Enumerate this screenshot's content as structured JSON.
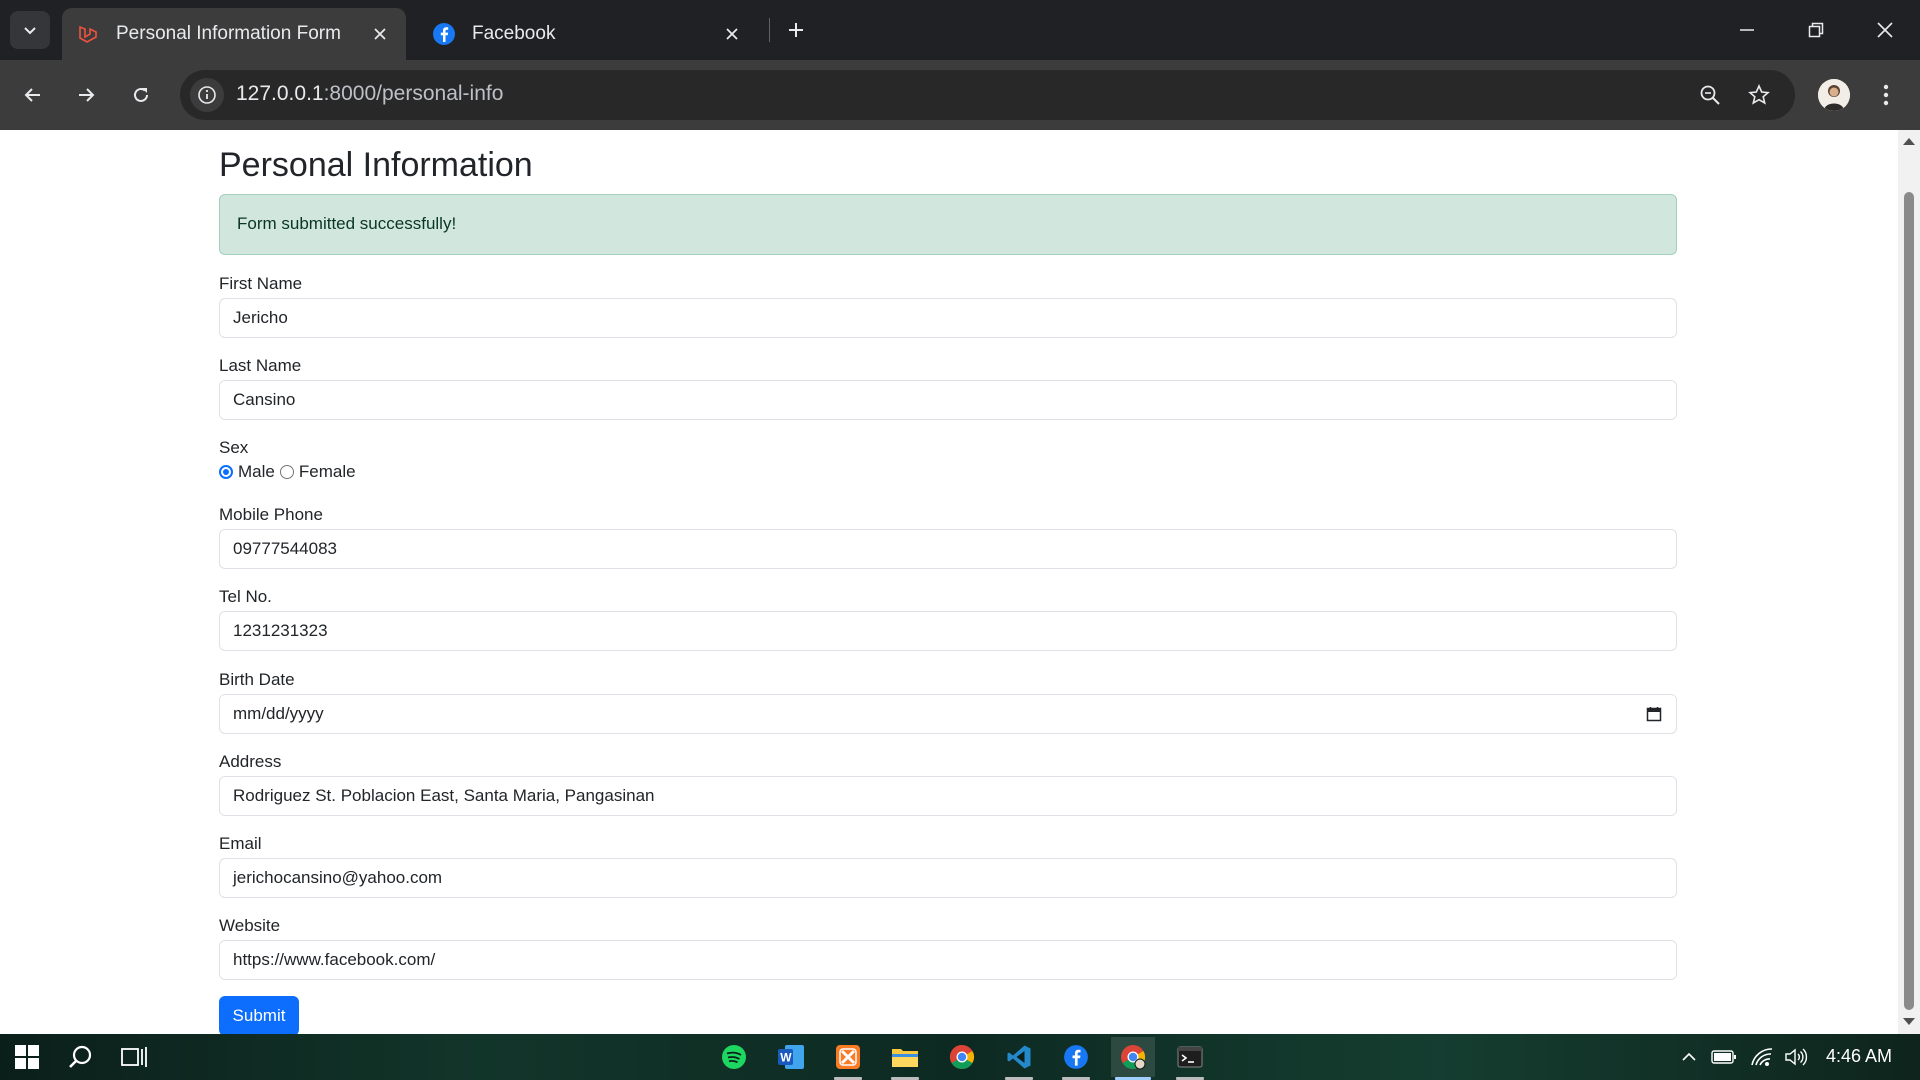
{
  "browser": {
    "tabs": [
      {
        "title": "Personal Information Form",
        "icon": "laravel-icon",
        "active": true
      },
      {
        "title": "Facebook",
        "icon": "facebook-icon",
        "active": false
      }
    ],
    "url_host": "127.0.0.1",
    "url_path": ":8000/personal-info"
  },
  "page": {
    "heading": "Personal Information",
    "alert": "Form submitted successfully!",
    "fields": {
      "first_name": {
        "label": "First Name",
        "value": "Jericho"
      },
      "last_name": {
        "label": "Last Name",
        "value": "Cansino"
      },
      "sex": {
        "label": "Sex",
        "options": [
          "Male",
          "Female"
        ],
        "selected": "Male"
      },
      "mobile": {
        "label": "Mobile Phone",
        "value": "09777544083"
      },
      "tel": {
        "label": "Tel No.",
        "value": "1231231323"
      },
      "birth_date": {
        "label": "Birth Date",
        "value": "mm/dd/yyyy"
      },
      "address": {
        "label": "Address",
        "value": "Rodriguez St. Poblacion East, Santa Maria, Pangasinan"
      },
      "email": {
        "label": "Email",
        "value": "jerichocansino@yahoo.com"
      },
      "website": {
        "label": "Website",
        "value": "https://www.facebook.com/"
      }
    },
    "submit_label": "Submit"
  },
  "taskbar": {
    "apps": [
      "spotify-icon",
      "word-icon",
      "xampp-icon",
      "file-explorer-icon",
      "chrome-icon",
      "vscode-icon",
      "facebook-icon",
      "chrome-profile-icon",
      "terminal-icon"
    ],
    "clock": "4:46 AM"
  },
  "colors": {
    "primary": "#0d6efd",
    "alert_bg": "#d1e7dd",
    "alert_text": "#0a3622"
  }
}
